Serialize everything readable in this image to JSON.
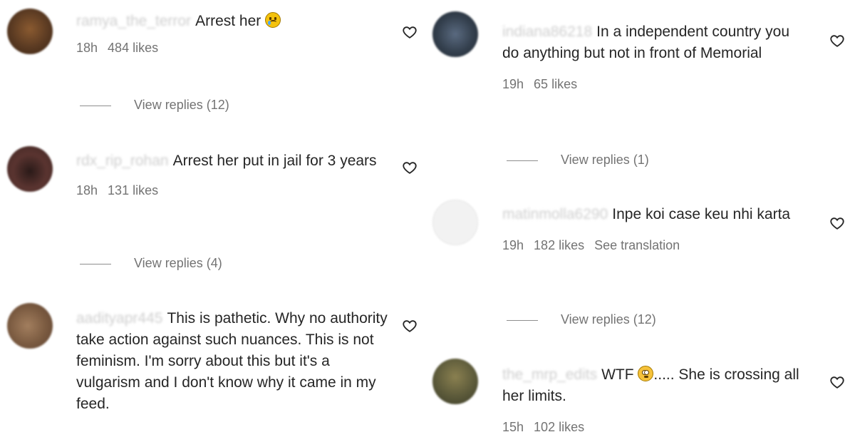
{
  "left_column": [
    {
      "username": "ramya_the_terror",
      "text": "Arrest her",
      "emoji": "crying-face",
      "time": "18h",
      "likes": "484 likes",
      "replies": "View replies (12)",
      "avatar_color": "#6b4a2a"
    },
    {
      "username": "rdx_rip_rohan",
      "text": "Arrest her put in jail for 3 years",
      "time": "18h",
      "likes": "131 likes",
      "replies": "View replies (4)",
      "avatar_color": "#4a2e28"
    },
    {
      "username": "aadityapr445",
      "text": "This is pathetic. Why no authority take action against such nuances. This is not feminism. I'm sorry about this but it's a vulgarism and I don't know why it came in my feed.",
      "avatar_color": "#8a6a4e"
    }
  ],
  "right_column": [
    {
      "username": "indiana86218",
      "text": "In a independent country you do anything but not in front of Memorial",
      "time": "19h",
      "likes": "65 likes",
      "replies": "View replies (1)",
      "avatar_color": "#3a4a5c"
    },
    {
      "username": "matinmolla6290",
      "text": "Inpe koi case keu nhi karta",
      "time": "19h",
      "likes": "182 likes",
      "translate": "See translation",
      "replies": "View replies (12)",
      "avatar_color": "#eeeeee"
    },
    {
      "username": "the_mrp_edits",
      "text_before": "WTF",
      "emoji": "flushed-face",
      "text_after": "..... She is crossing all her limits.",
      "time": "15h",
      "likes": "102 likes",
      "avatar_color": "#6f6a46"
    }
  ],
  "icons": {
    "like": "heart-outline-icon"
  },
  "colors": {
    "meta": "#737373",
    "text": "#262626"
  }
}
